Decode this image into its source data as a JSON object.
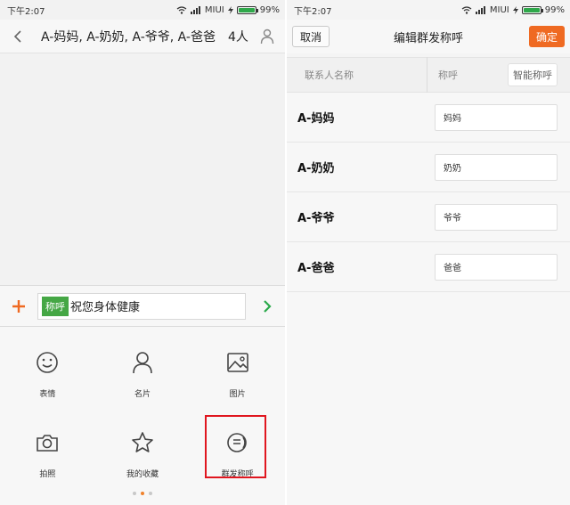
{
  "left": {
    "status": {
      "time": "下午2:07",
      "carrier": "MIUI",
      "battery": "99%"
    },
    "header": {
      "title": "A-妈妈, A-奶奶, A-爷爷, A-爸爸",
      "count": "4人"
    },
    "input": {
      "tag": "称呼",
      "text": "祝您身体健康"
    },
    "panel": {
      "items": [
        {
          "label": "表情",
          "icon": "smiley-icon"
        },
        {
          "label": "名片",
          "icon": "contact-card-icon"
        },
        {
          "label": "图片",
          "icon": "image-icon"
        },
        {
          "label": "拍照",
          "icon": "camera-icon"
        },
        {
          "label": "我的收藏",
          "icon": "star-icon"
        },
        {
          "label": "群发称呼",
          "icon": "group-salutation-icon"
        }
      ]
    }
  },
  "right": {
    "status": {
      "time": "下午2:07",
      "carrier": "MIUI",
      "battery": "99%"
    },
    "header": {
      "cancel": "取消",
      "title": "编辑群发称呼",
      "confirm": "确定"
    },
    "table": {
      "col_name": "联系人名称",
      "col_call": "称呼",
      "smart_button": "智能称呼",
      "rows": [
        {
          "name": "A-妈妈",
          "salutation": "妈妈"
        },
        {
          "name": "A-奶奶",
          "salutation": "奶奶"
        },
        {
          "name": "A-爷爷",
          "salutation": "爷爷"
        },
        {
          "name": "A-爸爸",
          "salutation": "爸爸"
        }
      ]
    }
  },
  "colors": {
    "accent_orange": "#ef6a22",
    "tag_green": "#45a745",
    "highlight_red": "#e0161f",
    "send_green": "#2aa94a"
  }
}
